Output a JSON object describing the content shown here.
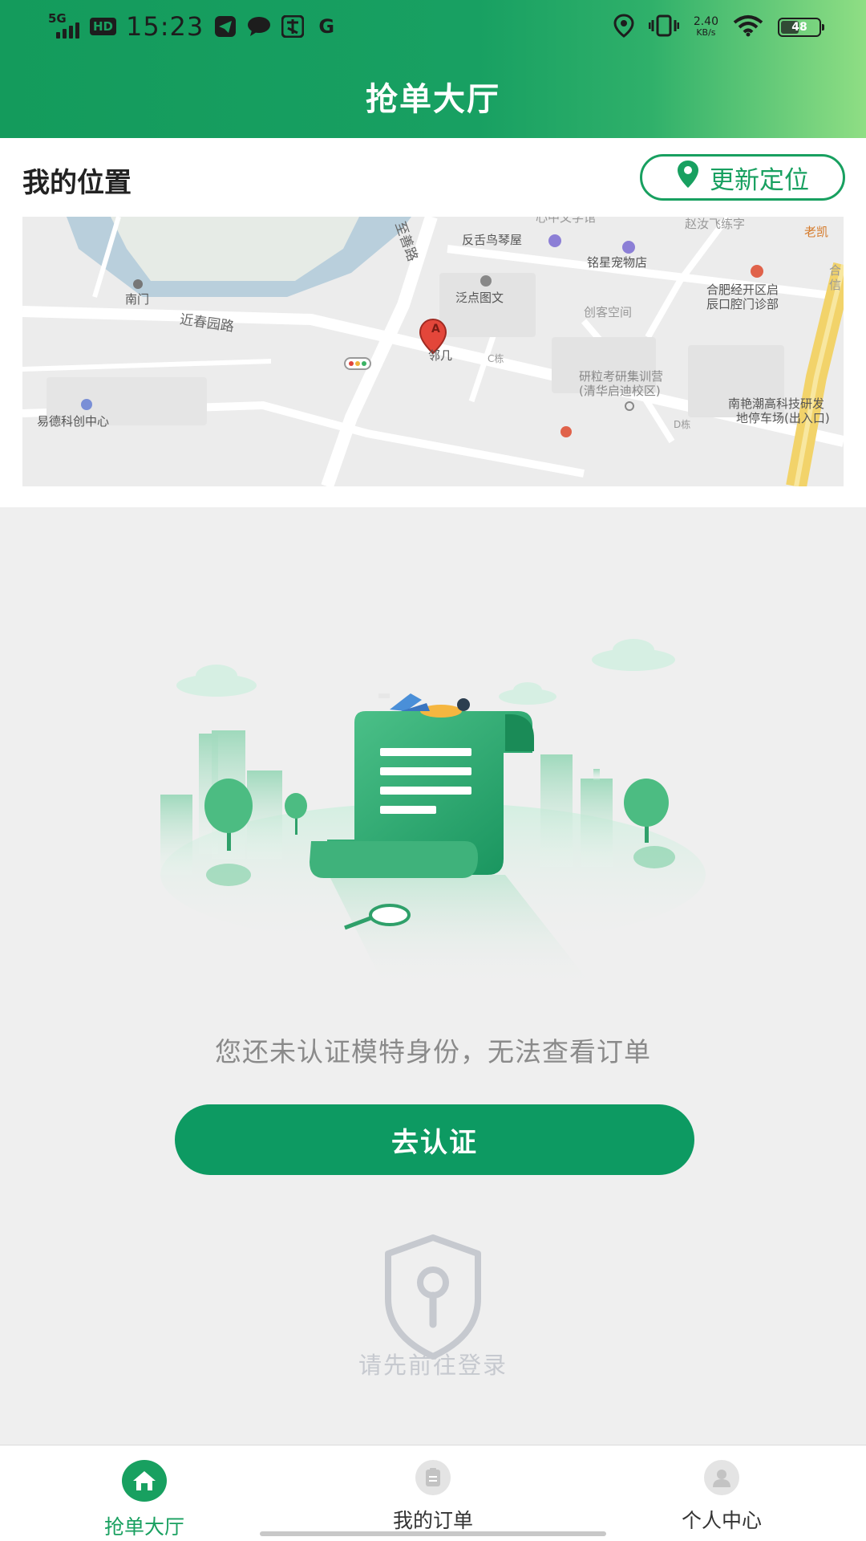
{
  "status_bar": {
    "network": "5G",
    "hd": "HD",
    "time": "15:23",
    "app_g": "G",
    "speed_value": "2.40",
    "speed_unit": "KB/s",
    "battery": "48",
    "battery_level": 0.48
  },
  "header": {
    "title": "抢单大厅"
  },
  "location": {
    "title": "我的位置",
    "update_button": "更新定位"
  },
  "map": {
    "labels": [
      "反舌鸟琴屋",
      "铭星宠物店",
      "赵汝飞练字",
      "老凯",
      "泛点图文",
      "合肥经开区启",
      "辰口腔门诊部",
      "创客空间",
      "南门",
      "近春园路",
      "至善路",
      "邻几",
      "C栋",
      "研粒考研集训营",
      "(清华启迪校区)",
      "易德科创中心",
      "D栋",
      "南艳潮高科技研发",
      "地停车场(出入口)",
      "合",
      "信",
      "心中文学馆"
    ],
    "pin_letter": "A"
  },
  "empty_state": {
    "message": "您还未认证模特身份，无法查看订单",
    "certify_button": "去认证",
    "login_hint": "请先前往登录"
  },
  "bottom_nav": {
    "items": [
      {
        "label": "抢单大厅",
        "icon": "home-icon",
        "active": true
      },
      {
        "label": "我的订单",
        "icon": "order-list-icon",
        "active": false
      },
      {
        "label": "个人中心",
        "icon": "user-icon",
        "active": false
      }
    ]
  },
  "colors": {
    "brand_green": "#18a060",
    "button_green": "#0d9a62",
    "muted_text": "#8a8a8a",
    "hint_text": "#c6c9cf"
  }
}
